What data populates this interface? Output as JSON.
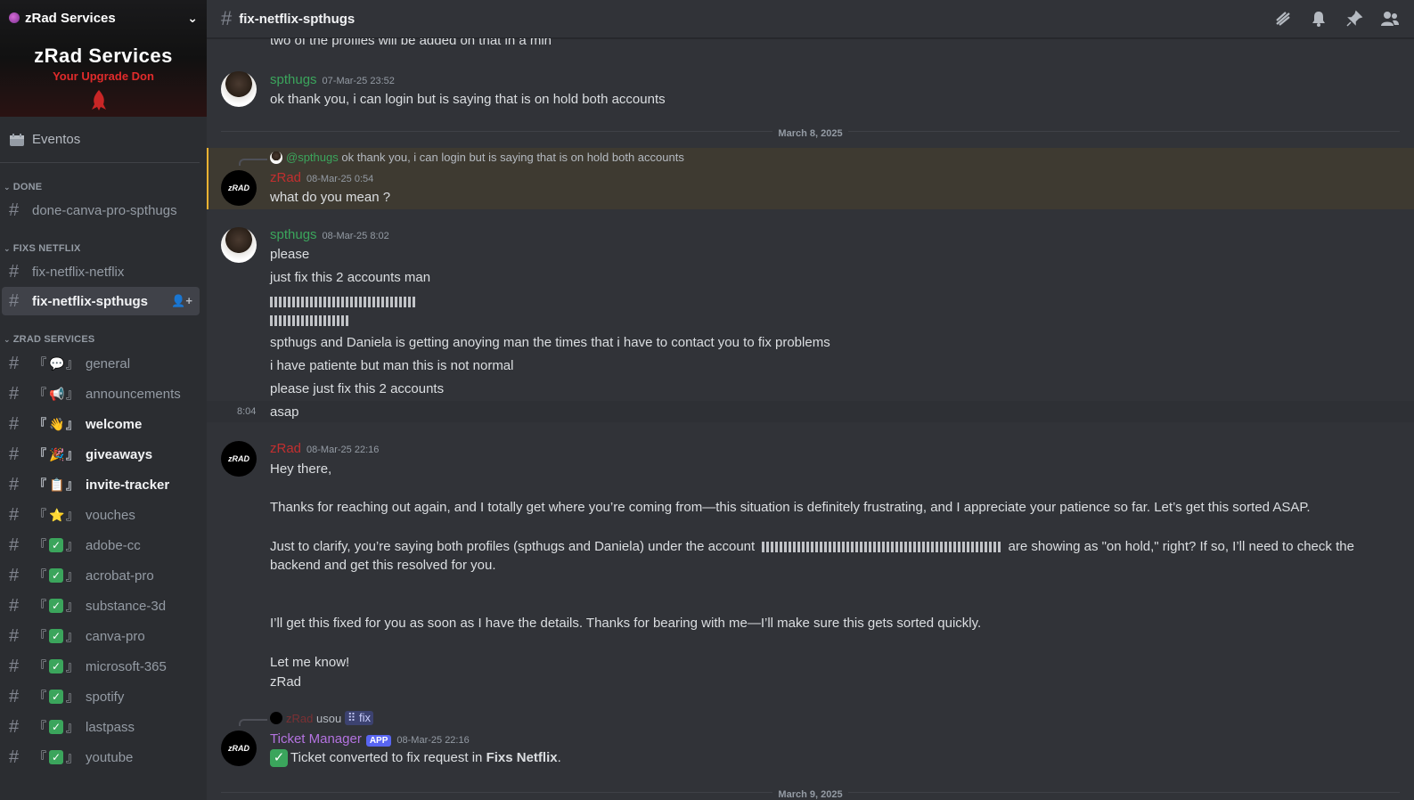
{
  "server": {
    "name": "zRad Services",
    "banner_title": "zRad Services",
    "banner_subtitle": "Your Upgrade Don"
  },
  "sidebar": {
    "events_label": "Eventos",
    "categories": [
      {
        "name": "DONE",
        "channels": [
          {
            "label": "done-canva-pro-spthugs",
            "emoji": ""
          }
        ]
      },
      {
        "name": "FIXS NETFLIX",
        "channels": [
          {
            "label": "fix-netflix-netflix",
            "emoji": ""
          },
          {
            "label": "fix-netflix-spthugs",
            "emoji": ""
          }
        ]
      },
      {
        "name": "ZRAD SERVICES",
        "channels": [
          {
            "label": "general",
            "emoji": "💬"
          },
          {
            "label": "announcements",
            "emoji": "📢"
          },
          {
            "label": "welcome",
            "emoji": "👋"
          },
          {
            "label": "giveaways",
            "emoji": "🎉"
          },
          {
            "label": "invite-tracker",
            "emoji": "📋"
          },
          {
            "label": "vouches",
            "emoji": "⭐"
          },
          {
            "label": "adobe-cc",
            "emoji": "✓"
          },
          {
            "label": "acrobat-pro",
            "emoji": "✓"
          },
          {
            "label": "substance-3d",
            "emoji": "✓"
          },
          {
            "label": "canva-pro",
            "emoji": "✓"
          },
          {
            "label": "microsoft-365",
            "emoji": "✓"
          },
          {
            "label": "spotify",
            "emoji": "✓"
          },
          {
            "label": "lastpass",
            "emoji": "✓"
          },
          {
            "label": "youtube",
            "emoji": "✓"
          }
        ]
      }
    ]
  },
  "topbar": {
    "channel_name": "fix-netflix-spthugs",
    "icons": [
      "threads-icon",
      "bell-icon",
      "pin-icon",
      "members-icon"
    ]
  },
  "chat": {
    "partial_top_line": "two of the profiles will be added on that in a min",
    "msg1": {
      "author": "spthugs",
      "timestamp": "07-Mar-25 23:52",
      "text": "ok thank you, i can login but is saying that is on hold both accounts"
    },
    "date_divider_1": "March 8, 2025",
    "msg2": {
      "reply_mention": "@spthugs",
      "reply_text": "ok thank you, i can login but is saying that is on hold both accounts",
      "author": "zRad",
      "timestamp": "08-Mar-25 0:54",
      "text": "what do you mean ?"
    },
    "msg3": {
      "author": "spthugs",
      "timestamp": "08-Mar-25 8:02",
      "lines": [
        "please",
        "just fix this 2 accounts man",
        "spthugs and Daniela is getting anoying man the times that i have to contact you to fix problems",
        "i have patiente but man this is not normal",
        "please just fix this 2 accounts"
      ],
      "followup_time": "8:04",
      "followup_text": "asap"
    },
    "msg4": {
      "author": "zRad",
      "timestamp": "08-Mar-25 22:16",
      "greeting": "Hey there,",
      "para1": "Thanks for reaching out again, and I totally get where you’re coming from—this situation is definitely frustrating, and I appreciate your patience so far. Let’s get this sorted ASAP.",
      "para2a": "Just to clarify, you’re saying both profiles (spthugs and Daniela) under the account",
      "para2b": "are showing as \"on hold,\" right? If so, I’ll need to check the",
      "para2c": "backend and get this resolved for you.",
      "para3": "I’ll get this fixed for you as soon as I have the details. Thanks for bearing with me—I’ll make sure this gets sorted quickly.",
      "closing1": "Let me know!",
      "closing2": "zRad"
    },
    "msg5": {
      "reply_author": "zRad",
      "reply_verb": "usou",
      "reply_cmd": "fix",
      "author": "Ticket Manager",
      "badge": "APP",
      "timestamp": "08-Mar-25 22:16",
      "text_prefix": "Ticket converted to fix request in",
      "text_bold": "Fixs Netflix",
      "text_suffix": "."
    },
    "date_divider_2": "March 9, 2025"
  },
  "colors": {
    "accent_green": "#3ba55c",
    "zrad_red": "#c22f2f",
    "ticket_purple": "#b473e0",
    "app_badge": "#5865f2",
    "highlight": "#3e3a31"
  }
}
